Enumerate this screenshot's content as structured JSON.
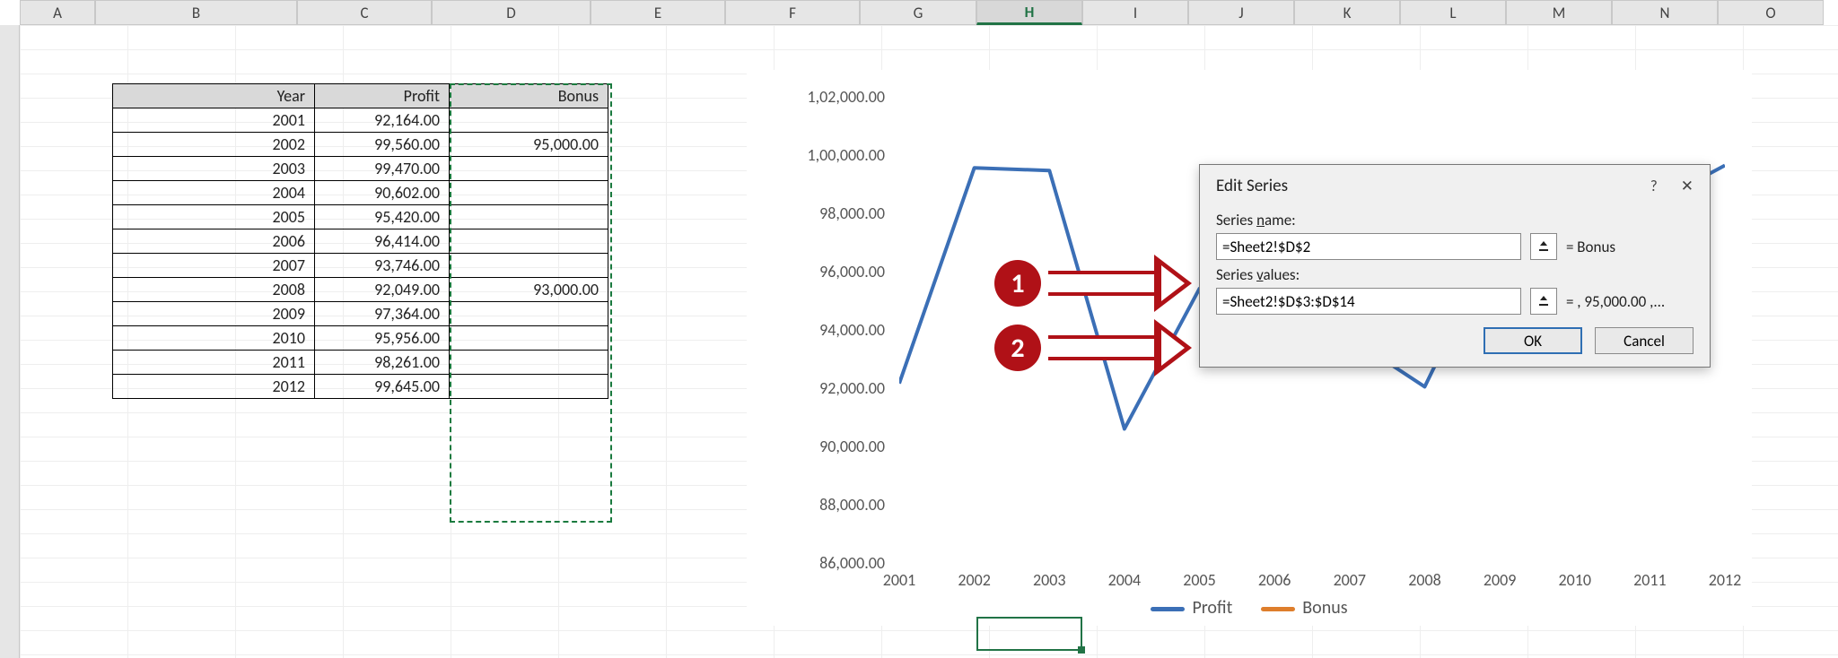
{
  "columns": [
    "A",
    "B",
    "C",
    "D",
    "E",
    "F",
    "G",
    "H",
    "I",
    "J",
    "K",
    "L",
    "M",
    "N",
    "O"
  ],
  "active_column": "H",
  "table": {
    "headers": {
      "year": "Year",
      "profit": "Profit",
      "bonus": "Bonus"
    },
    "rows": [
      {
        "year": "2001",
        "profit": "92,164.00",
        "bonus": ""
      },
      {
        "year": "2002",
        "profit": "99,560.00",
        "bonus": "95,000.00"
      },
      {
        "year": "2003",
        "profit": "99,470.00",
        "bonus": ""
      },
      {
        "year": "2004",
        "profit": "90,602.00",
        "bonus": ""
      },
      {
        "year": "2005",
        "profit": "95,420.00",
        "bonus": ""
      },
      {
        "year": "2006",
        "profit": "96,414.00",
        "bonus": ""
      },
      {
        "year": "2007",
        "profit": "93,746.00",
        "bonus": ""
      },
      {
        "year": "2008",
        "profit": "92,049.00",
        "bonus": "93,000.00"
      },
      {
        "year": "2009",
        "profit": "97,364.00",
        "bonus": ""
      },
      {
        "year": "2010",
        "profit": "95,956.00",
        "bonus": ""
      },
      {
        "year": "2011",
        "profit": "98,261.00",
        "bonus": ""
      },
      {
        "year": "2012",
        "profit": "99,645.00",
        "bonus": ""
      }
    ]
  },
  "chart_data": {
    "type": "line",
    "x": [
      "2001",
      "2002",
      "2003",
      "2004",
      "2005",
      "2006",
      "2007",
      "2008",
      "2009",
      "2010",
      "2011",
      "2012"
    ],
    "series": [
      {
        "name": "Profit",
        "color": "#3b6fb6",
        "values": [
          92164,
          99560,
          99470,
          90602,
          95420,
          96414,
          93746,
          92049,
          97364,
          95956,
          98261,
          99645
        ]
      },
      {
        "name": "Bonus",
        "color": "#de7e2c",
        "values": [
          null,
          95000,
          null,
          null,
          null,
          null,
          null,
          93000,
          null,
          null,
          null,
          null
        ]
      }
    ],
    "yticks": [
      "86,000.00",
      "88,000.00",
      "90,000.00",
      "92,000.00",
      "94,000.00",
      "96,000.00",
      "98,000.00",
      "1,00,000.00",
      "1,02,000.00"
    ],
    "ylim": [
      86000,
      102000
    ]
  },
  "dialog": {
    "title": "Edit Series",
    "series_name_label_pre": "Series ",
    "series_name_label_u": "n",
    "series_name_label_post": "ame:",
    "series_name_value": "=Sheet2!$D$2",
    "series_name_result": "= Bonus",
    "series_values_label_pre": "Series ",
    "series_values_label_u": "v",
    "series_values_label_post": "alues:",
    "series_values_value": "=Sheet2!$D$3:$D$14",
    "series_values_result": "= ,  95,000.00 ,...",
    "ok": "OK",
    "cancel": "Cancel",
    "help": "?",
    "close": "✕"
  },
  "callouts": {
    "one": "1",
    "two": "2"
  }
}
